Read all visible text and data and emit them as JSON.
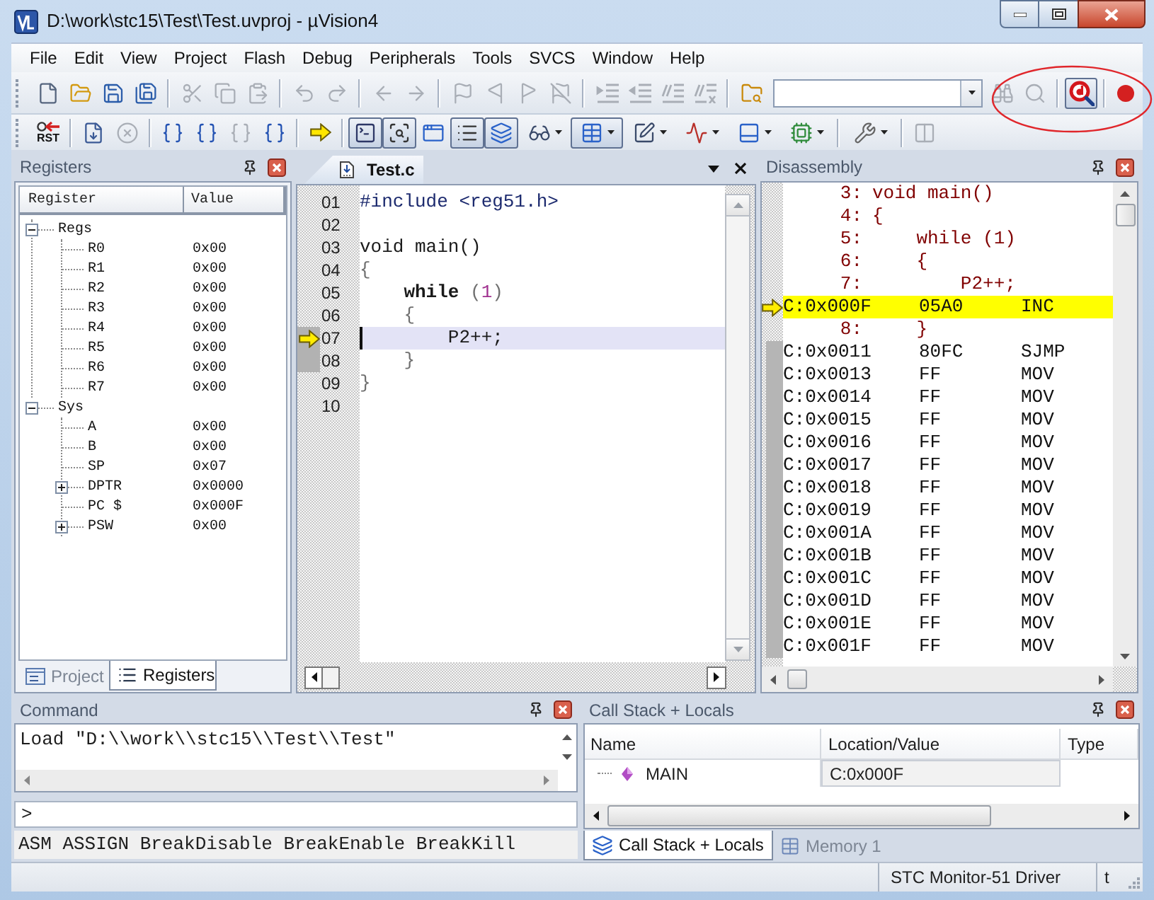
{
  "window": {
    "title": "D:\\work\\stc15\\Test\\Test.uvproj - µVision4"
  },
  "menu": [
    "File",
    "Edit",
    "View",
    "Project",
    "Flash",
    "Debug",
    "Peripherals",
    "Tools",
    "SVCS",
    "Window",
    "Help"
  ],
  "toolbar_1": [
    {
      "kind": "new",
      "disabled": false,
      "pressed": false
    },
    {
      "kind": "open",
      "disabled": false,
      "pressed": false
    },
    {
      "kind": "save",
      "disabled": false,
      "pressed": false
    },
    {
      "kind": "save_all",
      "disabled": false,
      "pressed": false
    },
    {
      "kind": "separator"
    },
    {
      "kind": "cut",
      "disabled": true,
      "pressed": false
    },
    {
      "kind": "copy",
      "disabled": true,
      "pressed": false
    },
    {
      "kind": "paste",
      "disabled": true,
      "pressed": false
    },
    {
      "kind": "separator"
    },
    {
      "kind": "undo",
      "disabled": true,
      "pressed": false
    },
    {
      "kind": "redo",
      "disabled": true,
      "pressed": false
    },
    {
      "kind": "separator"
    },
    {
      "kind": "back",
      "disabled": true,
      "pressed": false
    },
    {
      "kind": "forward",
      "disabled": true,
      "pressed": false
    },
    {
      "kind": "separator"
    },
    {
      "kind": "bookmark",
      "disabled": true,
      "pressed": false
    },
    {
      "kind": "bookmark_prev",
      "disabled": true,
      "pressed": false
    },
    {
      "kind": "bookmark_next",
      "disabled": true,
      "pressed": false
    },
    {
      "kind": "bookmark_clear",
      "disabled": true,
      "pressed": false
    },
    {
      "kind": "separator"
    },
    {
      "kind": "indent",
      "disabled": true,
      "pressed": false
    },
    {
      "kind": "unindent",
      "disabled": true,
      "pressed": false
    },
    {
      "kind": "comment",
      "disabled": true,
      "pressed": false
    },
    {
      "kind": "uncomment",
      "disabled": true,
      "pressed": false
    },
    {
      "kind": "separator"
    },
    {
      "kind": "find_in_files",
      "disabled": false,
      "pressed": false
    },
    {
      "kind": "combo"
    },
    {
      "kind": "find",
      "disabled": true,
      "pressed": false
    },
    {
      "kind": "incremental_find",
      "disabled": true,
      "pressed": false
    },
    {
      "kind": "separator"
    },
    {
      "kind": "debug",
      "disabled": false,
      "pressed": true
    },
    {
      "kind": "separator"
    },
    {
      "kind": "breakpoint",
      "disabled": false,
      "pressed": false
    }
  ],
  "toolbar_2": [
    {
      "kind": "reset",
      "label": "RST",
      "disabled": false,
      "pressed": false
    },
    {
      "kind": "separator"
    },
    {
      "kind": "run",
      "disabled": false,
      "pressed": false
    },
    {
      "kind": "stop",
      "disabled": true,
      "pressed": false
    },
    {
      "kind": "separator"
    },
    {
      "kind": "step_into",
      "disabled": false,
      "pressed": false
    },
    {
      "kind": "step_over",
      "disabled": false,
      "pressed": false
    },
    {
      "kind": "step_out",
      "disabled": true,
      "pressed": false
    },
    {
      "kind": "run_to_cursor",
      "disabled": false,
      "pressed": false
    },
    {
      "kind": "separator"
    },
    {
      "kind": "show_next",
      "disabled": false,
      "pressed": false
    },
    {
      "kind": "separator"
    },
    {
      "kind": "command_window",
      "disabled": false,
      "pressed": true
    },
    {
      "kind": "disassembly_window",
      "disabled": false,
      "pressed": true
    },
    {
      "kind": "symbols_window",
      "disabled": false,
      "pressed": false
    },
    {
      "kind": "registers_window",
      "disabled": false,
      "pressed": true
    },
    {
      "kind": "call_stack_window",
      "disabled": false,
      "pressed": true
    },
    {
      "kind": "watch_window",
      "dropdown": true,
      "disabled": false,
      "pressed": false
    },
    {
      "kind": "memory_window",
      "dropdown": true,
      "disabled": false,
      "pressed": true
    },
    {
      "kind": "serial_window",
      "dropdown": true,
      "disabled": false,
      "pressed": false
    },
    {
      "kind": "analysis_window",
      "dropdown": true,
      "disabled": false,
      "pressed": false
    },
    {
      "kind": "trace_window",
      "dropdown": true,
      "disabled": false,
      "pressed": false
    },
    {
      "kind": "system_viewer",
      "dropdown": true,
      "disabled": false,
      "pressed": false
    },
    {
      "kind": "separator"
    },
    {
      "kind": "toolbox",
      "dropdown": true,
      "disabled": false,
      "pressed": false
    },
    {
      "kind": "separator"
    },
    {
      "kind": "window_layout",
      "disabled": true,
      "pressed": false
    }
  ],
  "registers": {
    "title": "Registers",
    "columns": [
      "Register",
      "Value"
    ],
    "tree": [
      {
        "name": "Regs",
        "expanded": true,
        "children": [
          {
            "name": "R0",
            "value": "0x00"
          },
          {
            "name": "R1",
            "value": "0x00"
          },
          {
            "name": "R2",
            "value": "0x00"
          },
          {
            "name": "R3",
            "value": "0x00"
          },
          {
            "name": "R4",
            "value": "0x00"
          },
          {
            "name": "R5",
            "value": "0x00"
          },
          {
            "name": "R6",
            "value": "0x00"
          },
          {
            "name": "R7",
            "value": "0x00"
          }
        ]
      },
      {
        "name": "Sys",
        "expanded": true,
        "children": [
          {
            "name": "A",
            "value": "0x00"
          },
          {
            "name": "B",
            "value": "0x00"
          },
          {
            "name": "SP",
            "value": "0x07"
          },
          {
            "name": "DPTR",
            "value": "0x0000",
            "expanded": false
          },
          {
            "name": "PC $",
            "value": "0x000F"
          },
          {
            "name": "PSW",
            "value": "0x00",
            "expanded": false
          }
        ]
      }
    ],
    "tabs": [
      {
        "kind": "project",
        "label": "Project",
        "selected": false
      },
      {
        "kind": "registers",
        "label": "Registers",
        "selected": true
      }
    ]
  },
  "editor": {
    "tabs": [
      {
        "label": "Test.c",
        "selected": true
      }
    ],
    "lines": [
      {
        "number": "01",
        "current": false,
        "cursor": false,
        "executable": false,
        "segments": [
          {
            "kind": "preprocessor",
            "text": "#include <reg51.h>"
          }
        ]
      },
      {
        "number": "02",
        "current": false,
        "cursor": false,
        "executable": false
      },
      {
        "number": "03",
        "current": false,
        "cursor": false,
        "executable": false,
        "segments": [
          {
            "kind": "plain",
            "text": "void main()"
          }
        ]
      },
      {
        "number": "04",
        "current": false,
        "cursor": false,
        "executable": false,
        "segments": [
          {
            "kind": "operator",
            "text": "{"
          }
        ]
      },
      {
        "number": "05",
        "current": false,
        "cursor": false,
        "executable": false,
        "segments": [
          {
            "kind": "keyword",
            "text": "    while"
          },
          {
            "kind": "operator",
            "text": " ("
          },
          {
            "kind": "number",
            "text": "1"
          },
          {
            "kind": "operator",
            "text": ")"
          }
        ]
      },
      {
        "number": "06",
        "current": false,
        "cursor": false,
        "executable": false,
        "segments": [
          {
            "kind": "operator",
            "text": "    {"
          }
        ]
      },
      {
        "number": "07",
        "current": true,
        "cursor": true,
        "executable": true,
        "segments": [
          {
            "kind": "plain",
            "text": "        P2++;"
          }
        ]
      },
      {
        "number": "08",
        "current": false,
        "cursor": false,
        "executable": true,
        "segments": [
          {
            "kind": "operator",
            "text": "    }"
          }
        ]
      },
      {
        "number": "09",
        "current": false,
        "cursor": false,
        "executable": false,
        "segments": [
          {
            "kind": "operator",
            "text": "}"
          }
        ]
      },
      {
        "number": "10",
        "current": false,
        "cursor": false,
        "executable": false
      }
    ]
  },
  "disassembly": {
    "title": "Disassembly",
    "rows": [
      {
        "kind": "source",
        "line": "3:",
        "text": "void main()",
        "current": false
      },
      {
        "kind": "source",
        "line": "4:",
        "text": "{",
        "current": false
      },
      {
        "kind": "source",
        "line": "5:",
        "text": "    while (1)",
        "current": false
      },
      {
        "kind": "source",
        "line": "6:",
        "text": "    {",
        "current": false
      },
      {
        "kind": "source",
        "line": "7:",
        "text": "        P2++;",
        "current": false
      },
      {
        "kind": "asm",
        "address": "C:0x000F",
        "opcode": "05A0",
        "mnemonic": "INC",
        "current": true
      },
      {
        "kind": "source",
        "line": "8:",
        "text": "    }",
        "current": false
      },
      {
        "kind": "asm",
        "address": "C:0x0011",
        "opcode": "80FC",
        "mnemonic": "SJMP",
        "current": false
      },
      {
        "kind": "asm",
        "address": "C:0x0013",
        "opcode": "FF",
        "mnemonic": "MOV",
        "current": false
      },
      {
        "kind": "asm",
        "address": "C:0x0014",
        "opcode": "FF",
        "mnemonic": "MOV",
        "current": false
      },
      {
        "kind": "asm",
        "address": "C:0x0015",
        "opcode": "FF",
        "mnemonic": "MOV",
        "current": false
      },
      {
        "kind": "asm",
        "address": "C:0x0016",
        "opcode": "FF",
        "mnemonic": "MOV",
        "current": false
      },
      {
        "kind": "asm",
        "address": "C:0x0017",
        "opcode": "FF",
        "mnemonic": "MOV",
        "current": false
      },
      {
        "kind": "asm",
        "address": "C:0x0018",
        "opcode": "FF",
        "mnemonic": "MOV",
        "current": false
      },
      {
        "kind": "asm",
        "address": "C:0x0019",
        "opcode": "FF",
        "mnemonic": "MOV",
        "current": false
      },
      {
        "kind": "asm",
        "address": "C:0x001A",
        "opcode": "FF",
        "mnemonic": "MOV",
        "current": false
      },
      {
        "kind": "asm",
        "address": "C:0x001B",
        "opcode": "FF",
        "mnemonic": "MOV",
        "current": false
      },
      {
        "kind": "asm",
        "address": "C:0x001C",
        "opcode": "FF",
        "mnemonic": "MOV",
        "current": false
      },
      {
        "kind": "asm",
        "address": "C:0x001D",
        "opcode": "FF",
        "mnemonic": "MOV",
        "current": false
      },
      {
        "kind": "asm",
        "address": "C:0x001E",
        "opcode": "FF",
        "mnemonic": "MOV",
        "current": false
      },
      {
        "kind": "asm",
        "address": "C:0x001F",
        "opcode": "FF",
        "mnemonic": "MOV",
        "current": false
      }
    ]
  },
  "command": {
    "title": "Command",
    "output": [
      "Load \"D:\\\\work\\\\stc15\\\\Test\\\\Test\""
    ],
    "prompt": ">",
    "help": "ASM ASSIGN BreakDisable BreakEnable BreakKill"
  },
  "call_stack": {
    "title": "Call Stack + Locals",
    "columns": [
      "Name",
      "Location/Value",
      "Type"
    ],
    "rows": [
      {
        "name": "MAIN",
        "location": "C:0x000F"
      }
    ],
    "tabs": [
      {
        "kind": "call_stack",
        "label": "Call Stack + Locals",
        "selected": true
      },
      {
        "kind": "memory",
        "label": "Memory 1",
        "selected": false
      }
    ]
  },
  "status_bar": [
    "STC Monitor-51 Driver",
    "t"
  ]
}
